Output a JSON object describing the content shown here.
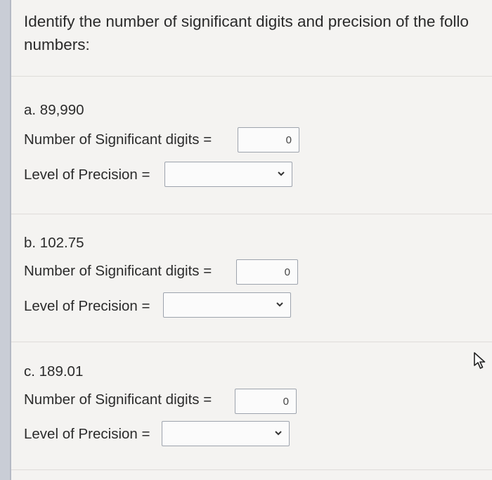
{
  "question": {
    "line1": "Identify the number of significant digits and precision of the follo",
    "line2": "numbers:"
  },
  "labels": {
    "sig_digits": "Number of Significant digits =",
    "precision": "Level of Precision ="
  },
  "items": [
    {
      "label": "a. 89,990",
      "sig_digits_value": "0",
      "precision_value": ""
    },
    {
      "label": "b. 102.75",
      "sig_digits_value": "0",
      "precision_value": ""
    },
    {
      "label": "c. 189.01",
      "sig_digits_value": "0",
      "precision_value": ""
    }
  ],
  "icons": {
    "dropdown": "chevron-down-icon",
    "cursor": "mouse-pointer-icon"
  },
  "colors": {
    "background": "#f4f3f1",
    "input_border": "#9da3ad",
    "left_bar": "#c9cdd6"
  }
}
